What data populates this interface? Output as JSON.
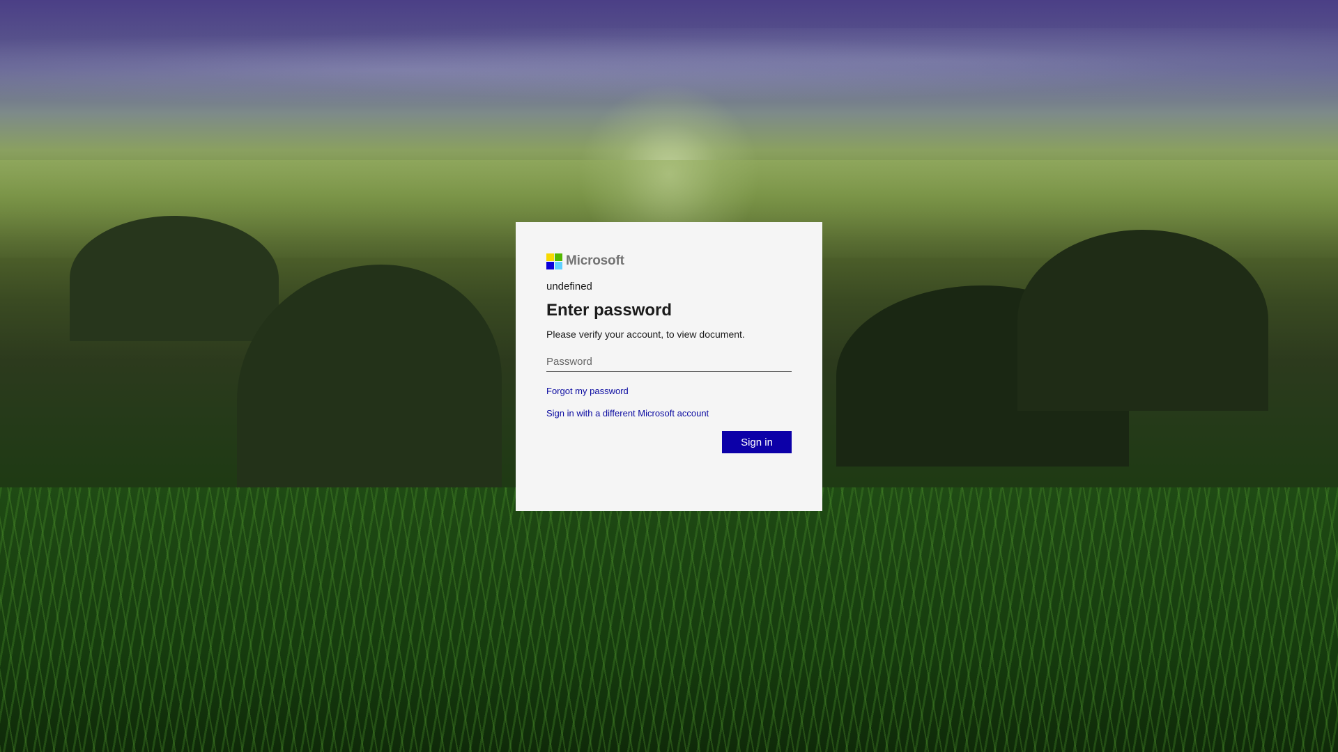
{
  "brand": {
    "name": "Microsoft",
    "logo_colors": [
      "#f7d900",
      "#53b800",
      "#0c00d8",
      "#5fd0ff"
    ]
  },
  "card": {
    "identity": "undefined",
    "title": "Enter password",
    "description": "Please verify your account, to view document.",
    "password_placeholder": "Password",
    "forgot_link": "Forgot my password",
    "other_account_link": "Sign in with a different Microsoft account",
    "signin_label": "Sign in"
  },
  "colors": {
    "accent": "#0c00a8",
    "link": "#0a0aa0",
    "card_bg": "#f5f5f5"
  }
}
